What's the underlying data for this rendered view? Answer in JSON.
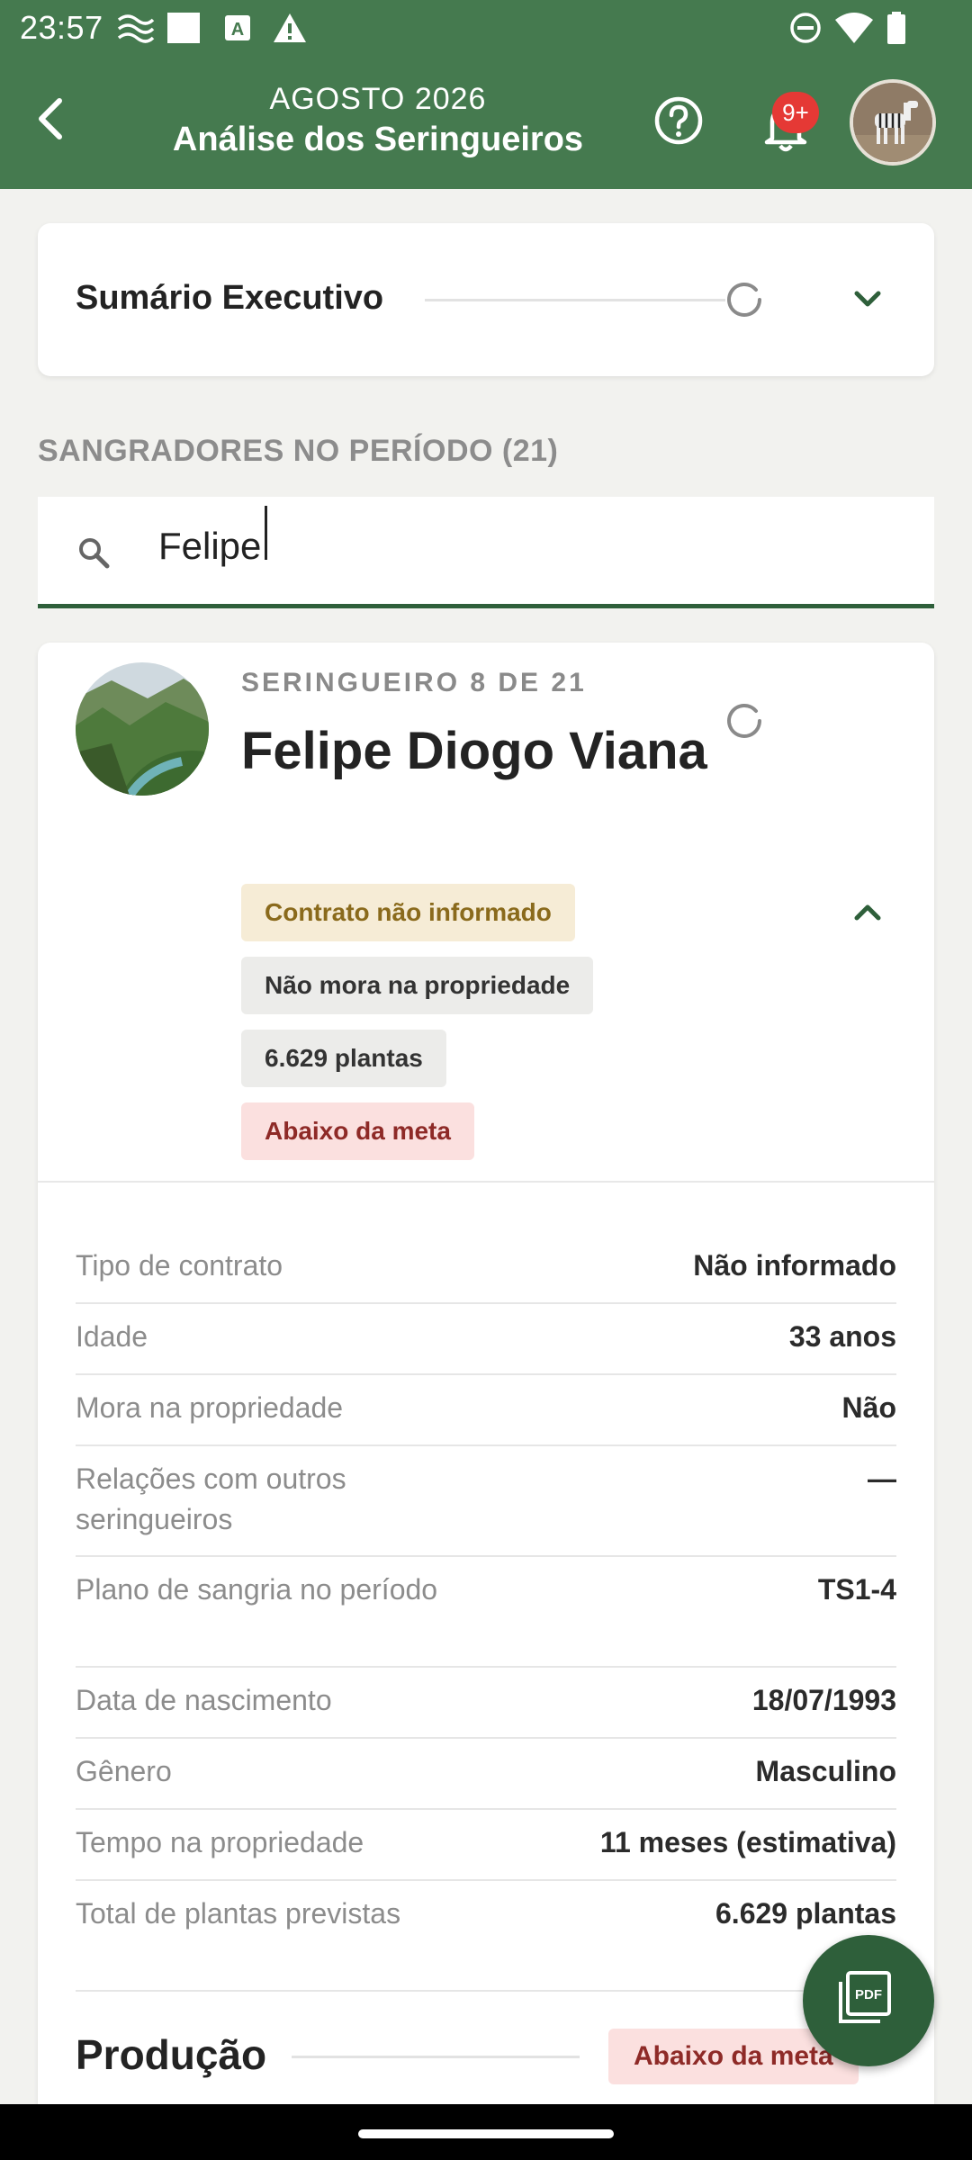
{
  "status_bar": {
    "time": "23:57",
    "left_icons": [
      "signal-waves-icon",
      "square-app-icon",
      "a-app-icon",
      "alert-triangle-icon"
    ],
    "right_icons": [
      "do-not-disturb-icon",
      "wifi-icon",
      "battery-icon"
    ]
  },
  "app_bar": {
    "subtitle": "AGOSTO 2026",
    "title": "Análise dos Seringueiros",
    "back_icon": "chevron-left-icon",
    "help_icon": "help-circle-icon",
    "bell_icon": "bell-icon",
    "notification_badge": "9+",
    "avatar_icon": "zebra-avatar"
  },
  "summary": {
    "title": "Sumário Executivo",
    "status_icon": "loading-spinner-icon",
    "toggle_icon": "chevron-down-icon"
  },
  "section": {
    "label": "SANGRADORES NO PERÍODO (21)"
  },
  "search": {
    "value": "Felipe",
    "icon": "search-icon"
  },
  "person": {
    "counter": "SERINGUEIRO 8 DE 21",
    "name": "Felipe Diogo Viana",
    "status_icon": "loading-spinner-icon",
    "toggle_icon": "chevron-up-icon",
    "chips": [
      "Contrato não informado",
      "Não mora na propriedade",
      "6.629 plantas",
      "Abaixo da meta"
    ],
    "details": [
      {
        "label": "Tipo de contrato",
        "value": "Não informado"
      },
      {
        "label": "Idade",
        "value": "33 anos"
      },
      {
        "label": "Mora na propriedade",
        "value": "Não"
      },
      {
        "label": "Relações com outros seringueiros",
        "value": "—"
      },
      {
        "label": "Plano de sangria no período",
        "value": "TS1-4"
      },
      {
        "label": "Data de nascimento",
        "value": "18/07/1993"
      },
      {
        "label": "Gênero",
        "value": "Masculino"
      },
      {
        "label": "Tempo na propriedade",
        "value": "11 meses (estimativa)"
      },
      {
        "label": "Total de plantas previstas",
        "value": "6.629 plantas"
      }
    ]
  },
  "production": {
    "title": "Produção",
    "status": "Abaixo da meta"
  },
  "fab": {
    "icon": "pdf-export-icon"
  },
  "colors": {
    "primary": "#457a4f",
    "primary_dark": "#2e5f3a",
    "badge": "#e53935",
    "warn_bg": "#f6ecd6",
    "bad_bg": "#fbe0df"
  }
}
